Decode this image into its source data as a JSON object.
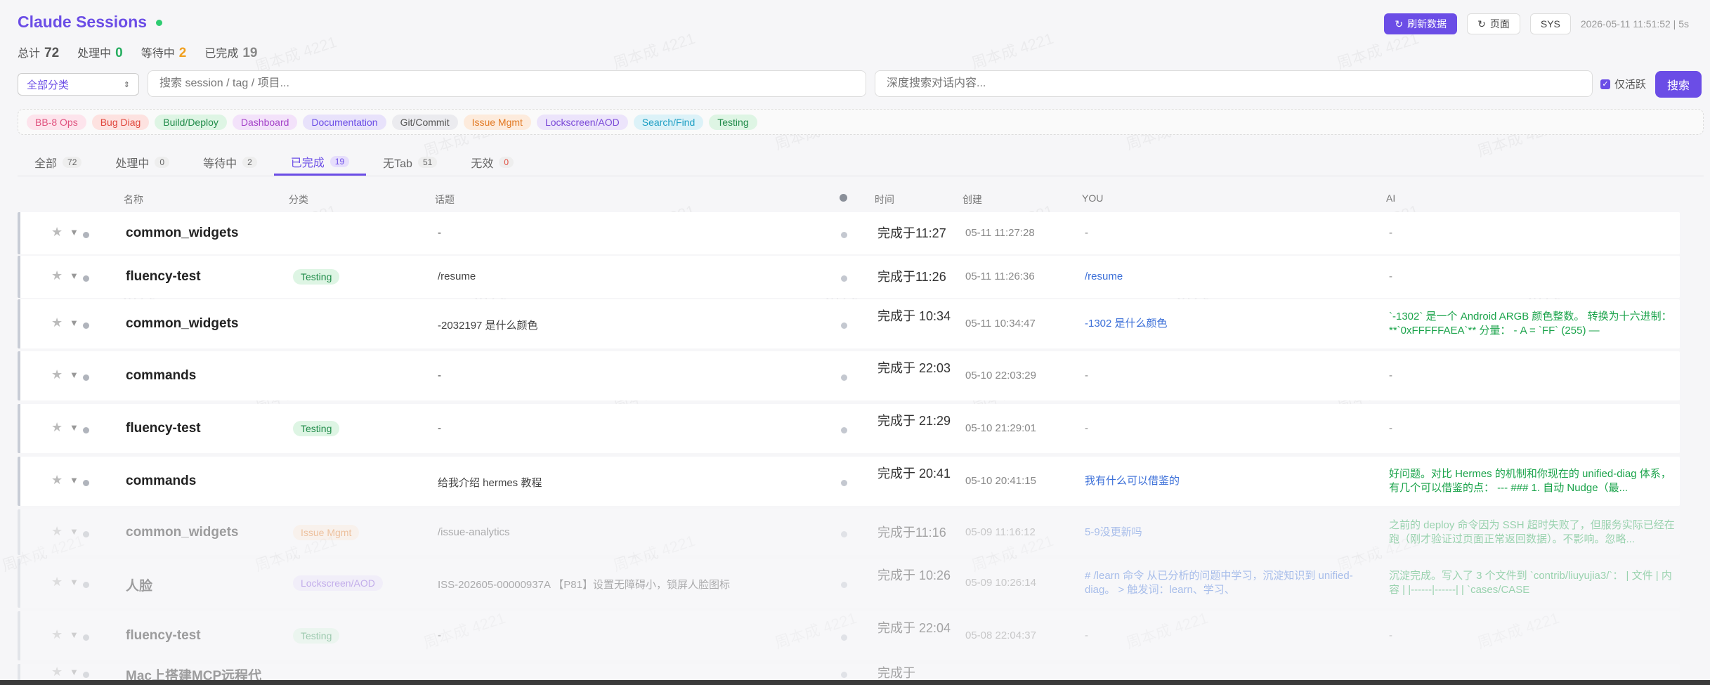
{
  "header": {
    "title": "Claude Sessions",
    "refresh_label": "刷新数据",
    "page_label": "页面",
    "sys_label": "SYS",
    "clock": "2026-05-11 11:51:52 | 5s"
  },
  "stats": {
    "total_label": "总计",
    "total": "72",
    "processing_label": "处理中",
    "processing": "0",
    "waiting_label": "等待中",
    "waiting": "2",
    "done_label": "已完成",
    "done": "19",
    "colors": {
      "processing": "#27ae60",
      "waiting": "#f0a020",
      "done": "#888888"
    }
  },
  "filters": {
    "category": "全部分类",
    "search_placeholder": "搜索 session / tag / 项目...",
    "deep_placeholder": "深度搜索对话内容...",
    "active_only": "仅活跃",
    "search_button": "搜索"
  },
  "tags": [
    {
      "label": "BB-8 Ops",
      "bg": "#fde4ec",
      "fg": "#e0527e"
    },
    {
      "label": "Bug Diag",
      "bg": "#fde2e0",
      "fg": "#e0463c"
    },
    {
      "label": "Build/Deploy",
      "bg": "#def5e4",
      "fg": "#218c4a"
    },
    {
      "label": "Dashboard",
      "bg": "#f3e2fa",
      "fg": "#a442c8"
    },
    {
      "label": "Documentation",
      "bg": "#e8e2fb",
      "fg": "#6b4de6"
    },
    {
      "label": "Git/Commit",
      "bg": "#ebebef",
      "fg": "#555555"
    },
    {
      "label": "Issue Mgmt",
      "bg": "#fdebdc",
      "fg": "#e27a24"
    },
    {
      "label": "Lockscreen/AOD",
      "bg": "#ece4fb",
      "fg": "#7b4ad8"
    },
    {
      "label": "Search/Find",
      "bg": "#dcf2f8",
      "fg": "#1e9fc4"
    },
    {
      "label": "Testing",
      "bg": "#def5e4",
      "fg": "#218c4a"
    }
  ],
  "tabs": [
    {
      "label": "全部",
      "count": "72"
    },
    {
      "label": "处理中",
      "count": "0"
    },
    {
      "label": "等待中",
      "count": "2"
    },
    {
      "label": "已完成",
      "count": "19"
    },
    {
      "label": "无Tab",
      "count": "51"
    },
    {
      "label": "无效",
      "count": "0"
    }
  ],
  "columns": {
    "name": "名称",
    "category": "分类",
    "topic": "话题",
    "time": "时间",
    "created": "创建",
    "you": "YOU",
    "ai": "AI"
  },
  "rows": [
    {
      "name": "common_widgets",
      "category": "",
      "topic": "-",
      "time": "完成于11:27",
      "created": "05-11 11:27:28",
      "you": "-",
      "ai": "-"
    },
    {
      "name": "fluency-test",
      "category": "Testing",
      "topic": "/resume",
      "time": "完成于11:26",
      "created": "05-11 11:26:36",
      "you": "/resume",
      "ai": "-"
    },
    {
      "name": "common_widgets",
      "category": "",
      "topic": "-2032197 是什么颜色",
      "time": "完成于 10:34",
      "created": "05-11 10:34:47",
      "you": "-1302 是什么颜色",
      "ai": "`-1302` 是一个 Android ARGB 颜色整数。 转换为十六进制：**`0xFFFFFAEA`** 分量： - A = `FF` (255) —"
    },
    {
      "name": "commands",
      "category": "",
      "topic": "-",
      "time": "完成于 22:03",
      "created": "05-10 22:03:29",
      "you": "-",
      "ai": "-"
    },
    {
      "name": "fluency-test",
      "category": "Testing",
      "topic": "-",
      "time": "完成于 21:29",
      "created": "05-10 21:29:01",
      "you": "-",
      "ai": "-"
    },
    {
      "name": "commands",
      "category": "",
      "topic": "给我介绍 hermes 教程",
      "time": "完成于 20:41",
      "created": "05-10 20:41:15",
      "you": "我有什么可以借鉴的",
      "ai": "好问题。对比 Hermes 的机制和你现在的 unified-diag 体系，有几个可以借鉴的点： --- ### 1. 自动 Nudge（最..."
    },
    {
      "name": "common_widgets",
      "category": "Issue Mgmt",
      "topic": "/issue-analytics",
      "time": "完成于11:16",
      "created": "05-09 11:16:12",
      "you": "5-9没更新吗",
      "ai": "之前的 deploy 命令因为 SSH 超时失败了，但服务实际已经在跑（刚才验证过页面正常返回数据）。不影响。忽略..."
    },
    {
      "name": "人脸",
      "category": "Lockscreen/AOD",
      "topic": "ISS-202605-00000937A 【P81】设置无障碍小，锁屏人脸图标",
      "time": "完成于 10:26",
      "created": "05-09 10:26:14",
      "you": "# /learn 命令 从已分析的问题中学习，沉淀知识到 unified-diag。 > 触发词：learn、学习、",
      "ai": "沉淀完成。写入了 3 个文件到 `contrib/liuyujia3/`： | 文件 | 内容 | |------|------| | `cases/CASE"
    },
    {
      "name": "fluency-test",
      "category": "Testing",
      "topic": "-",
      "time": "完成于 22:04",
      "created": "05-08 22:04:37",
      "you": "-",
      "ai": "-"
    },
    {
      "name": "Mac上搭建MCP远程代",
      "category": "",
      "topic": "",
      "time": "完成于",
      "created": "",
      "you": "",
      "ai": ""
    }
  ],
  "watermark": "周本成 4221"
}
